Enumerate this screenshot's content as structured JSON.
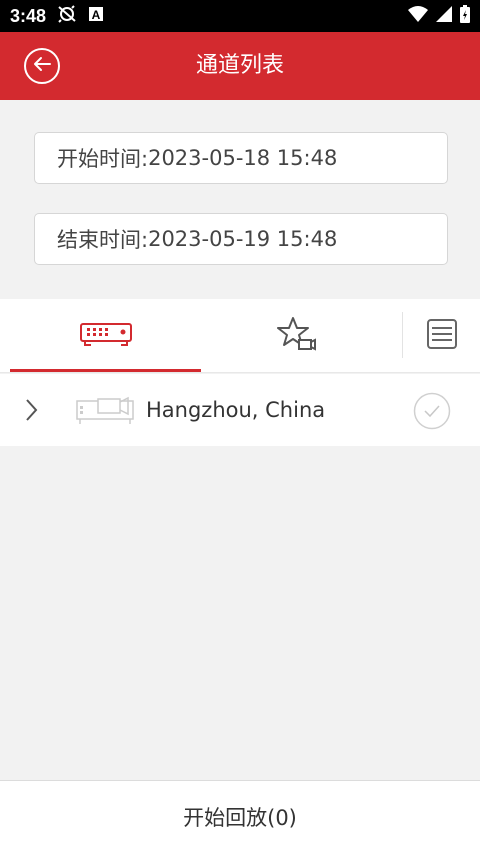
{
  "status_bar": {
    "time": "3:48",
    "icons": [
      "sync-off-icon",
      "keyboard-a-icon",
      "wifi-icon",
      "signal-icon",
      "battery-charging-icon"
    ]
  },
  "header": {
    "title": "通道列表",
    "back_icon": "back-arrow-icon"
  },
  "time_range": {
    "start_label": "开始时间:",
    "start_value": "2023-05-18 15:48",
    "end_label": "结束时间:",
    "end_value": "2023-05-19 15:48"
  },
  "tabs": [
    {
      "icon": "nvr-device-icon",
      "active": true
    },
    {
      "icon": "favorite-camera-icon",
      "active": false
    },
    {
      "icon": "list-icon",
      "active": false
    }
  ],
  "devices": [
    {
      "name": "Hangzhou, China",
      "expand_icon": "chevron-right-icon",
      "device_icon": "dvr-camera-icon",
      "select_icon": "check-circle-icon"
    }
  ],
  "footer": {
    "playback_label": "开始回放(0)"
  },
  "colors": {
    "accent": "#d32a2f",
    "background": "#f2f2f2"
  }
}
